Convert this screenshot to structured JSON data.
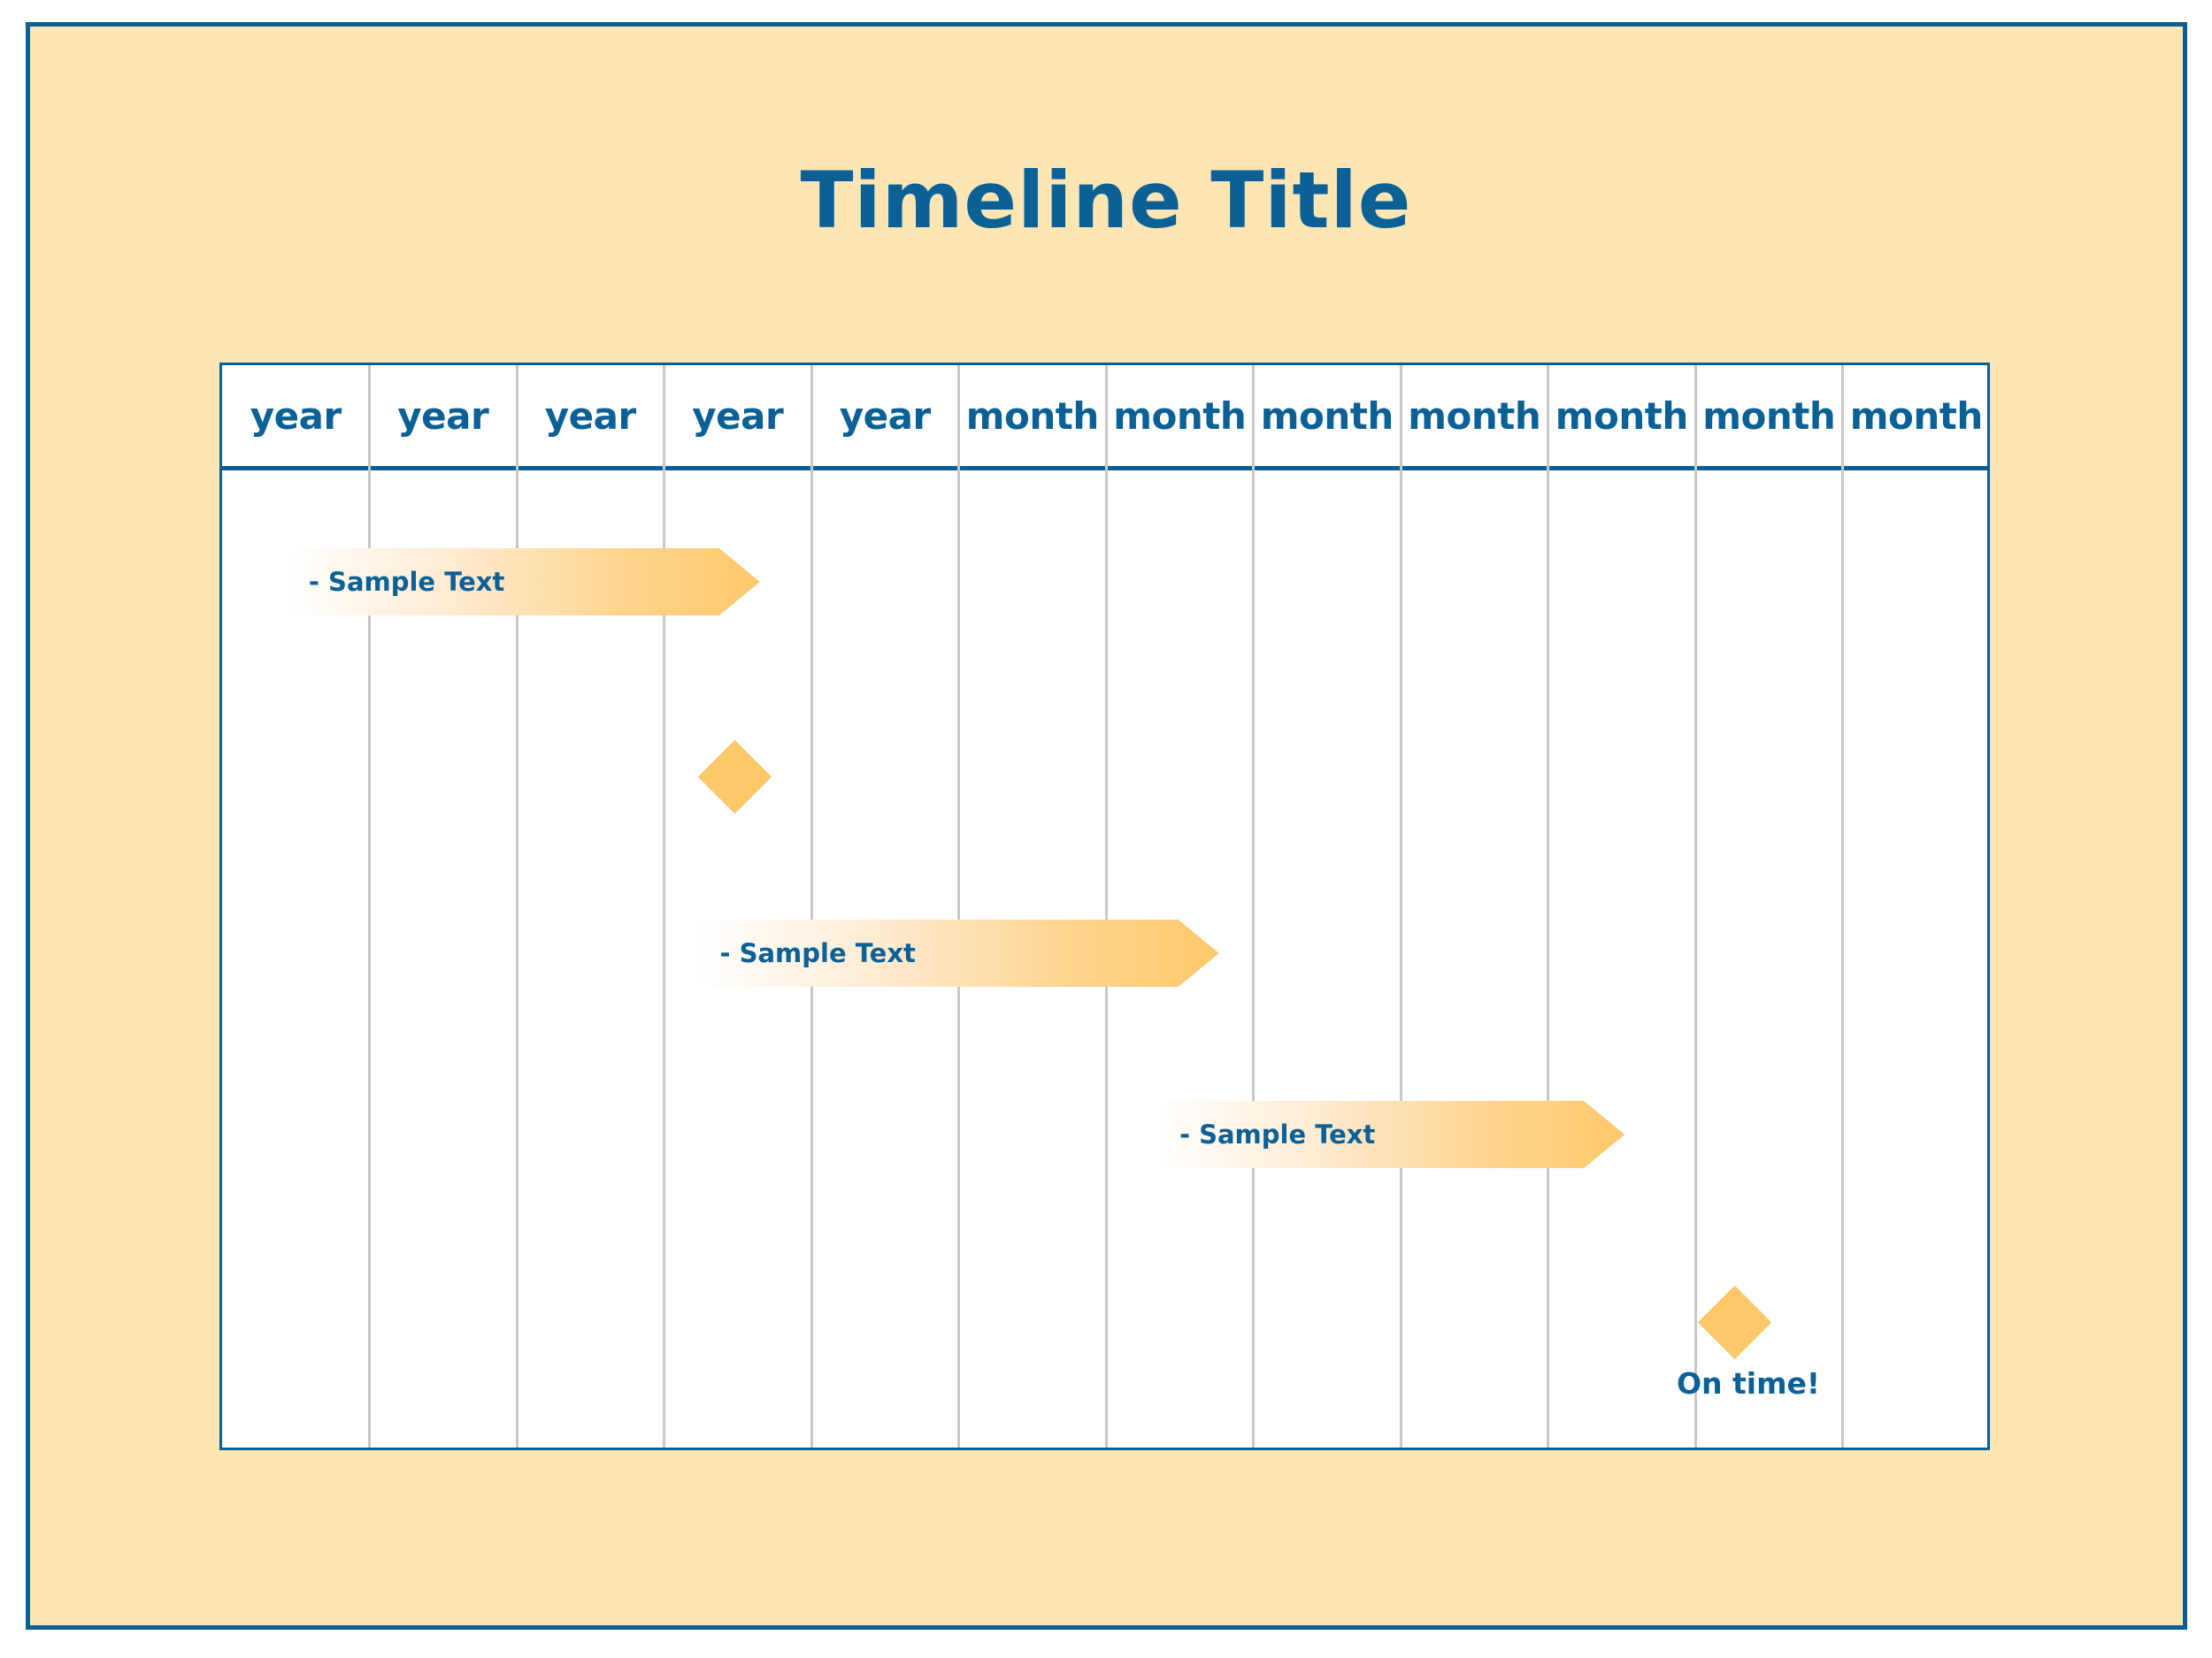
{
  "title": "Timeline Title",
  "colors": {
    "frame_border": "#0B5E96",
    "frame_fill": "#FDE5B4",
    "text": "#0B6096",
    "grid_line": "#C8C8C8",
    "accent": "#FDC86A",
    "accent_light": "#FFFFFF"
  },
  "columns": [
    {
      "label": "year"
    },
    {
      "label": "year"
    },
    {
      "label": "year"
    },
    {
      "label": "year"
    },
    {
      "label": "year"
    },
    {
      "label": "month"
    },
    {
      "label": "month"
    },
    {
      "label": "month"
    },
    {
      "label": "month"
    },
    {
      "label": "month"
    },
    {
      "label": "month"
    },
    {
      "label": "month"
    }
  ],
  "tasks": [
    {
      "label": "- Sample Text",
      "start_col": 0.42,
      "end_col": 3.65
    },
    {
      "label": "- Sample Text",
      "start_col": 3.21,
      "end_col": 6.77
    },
    {
      "label": "- Sample Text",
      "start_col": 6.33,
      "end_col": 9.52
    }
  ],
  "milestones": [
    {
      "label": "",
      "at_col": 3.48
    },
    {
      "label": "On time!",
      "at_col": 10.27
    }
  ]
}
